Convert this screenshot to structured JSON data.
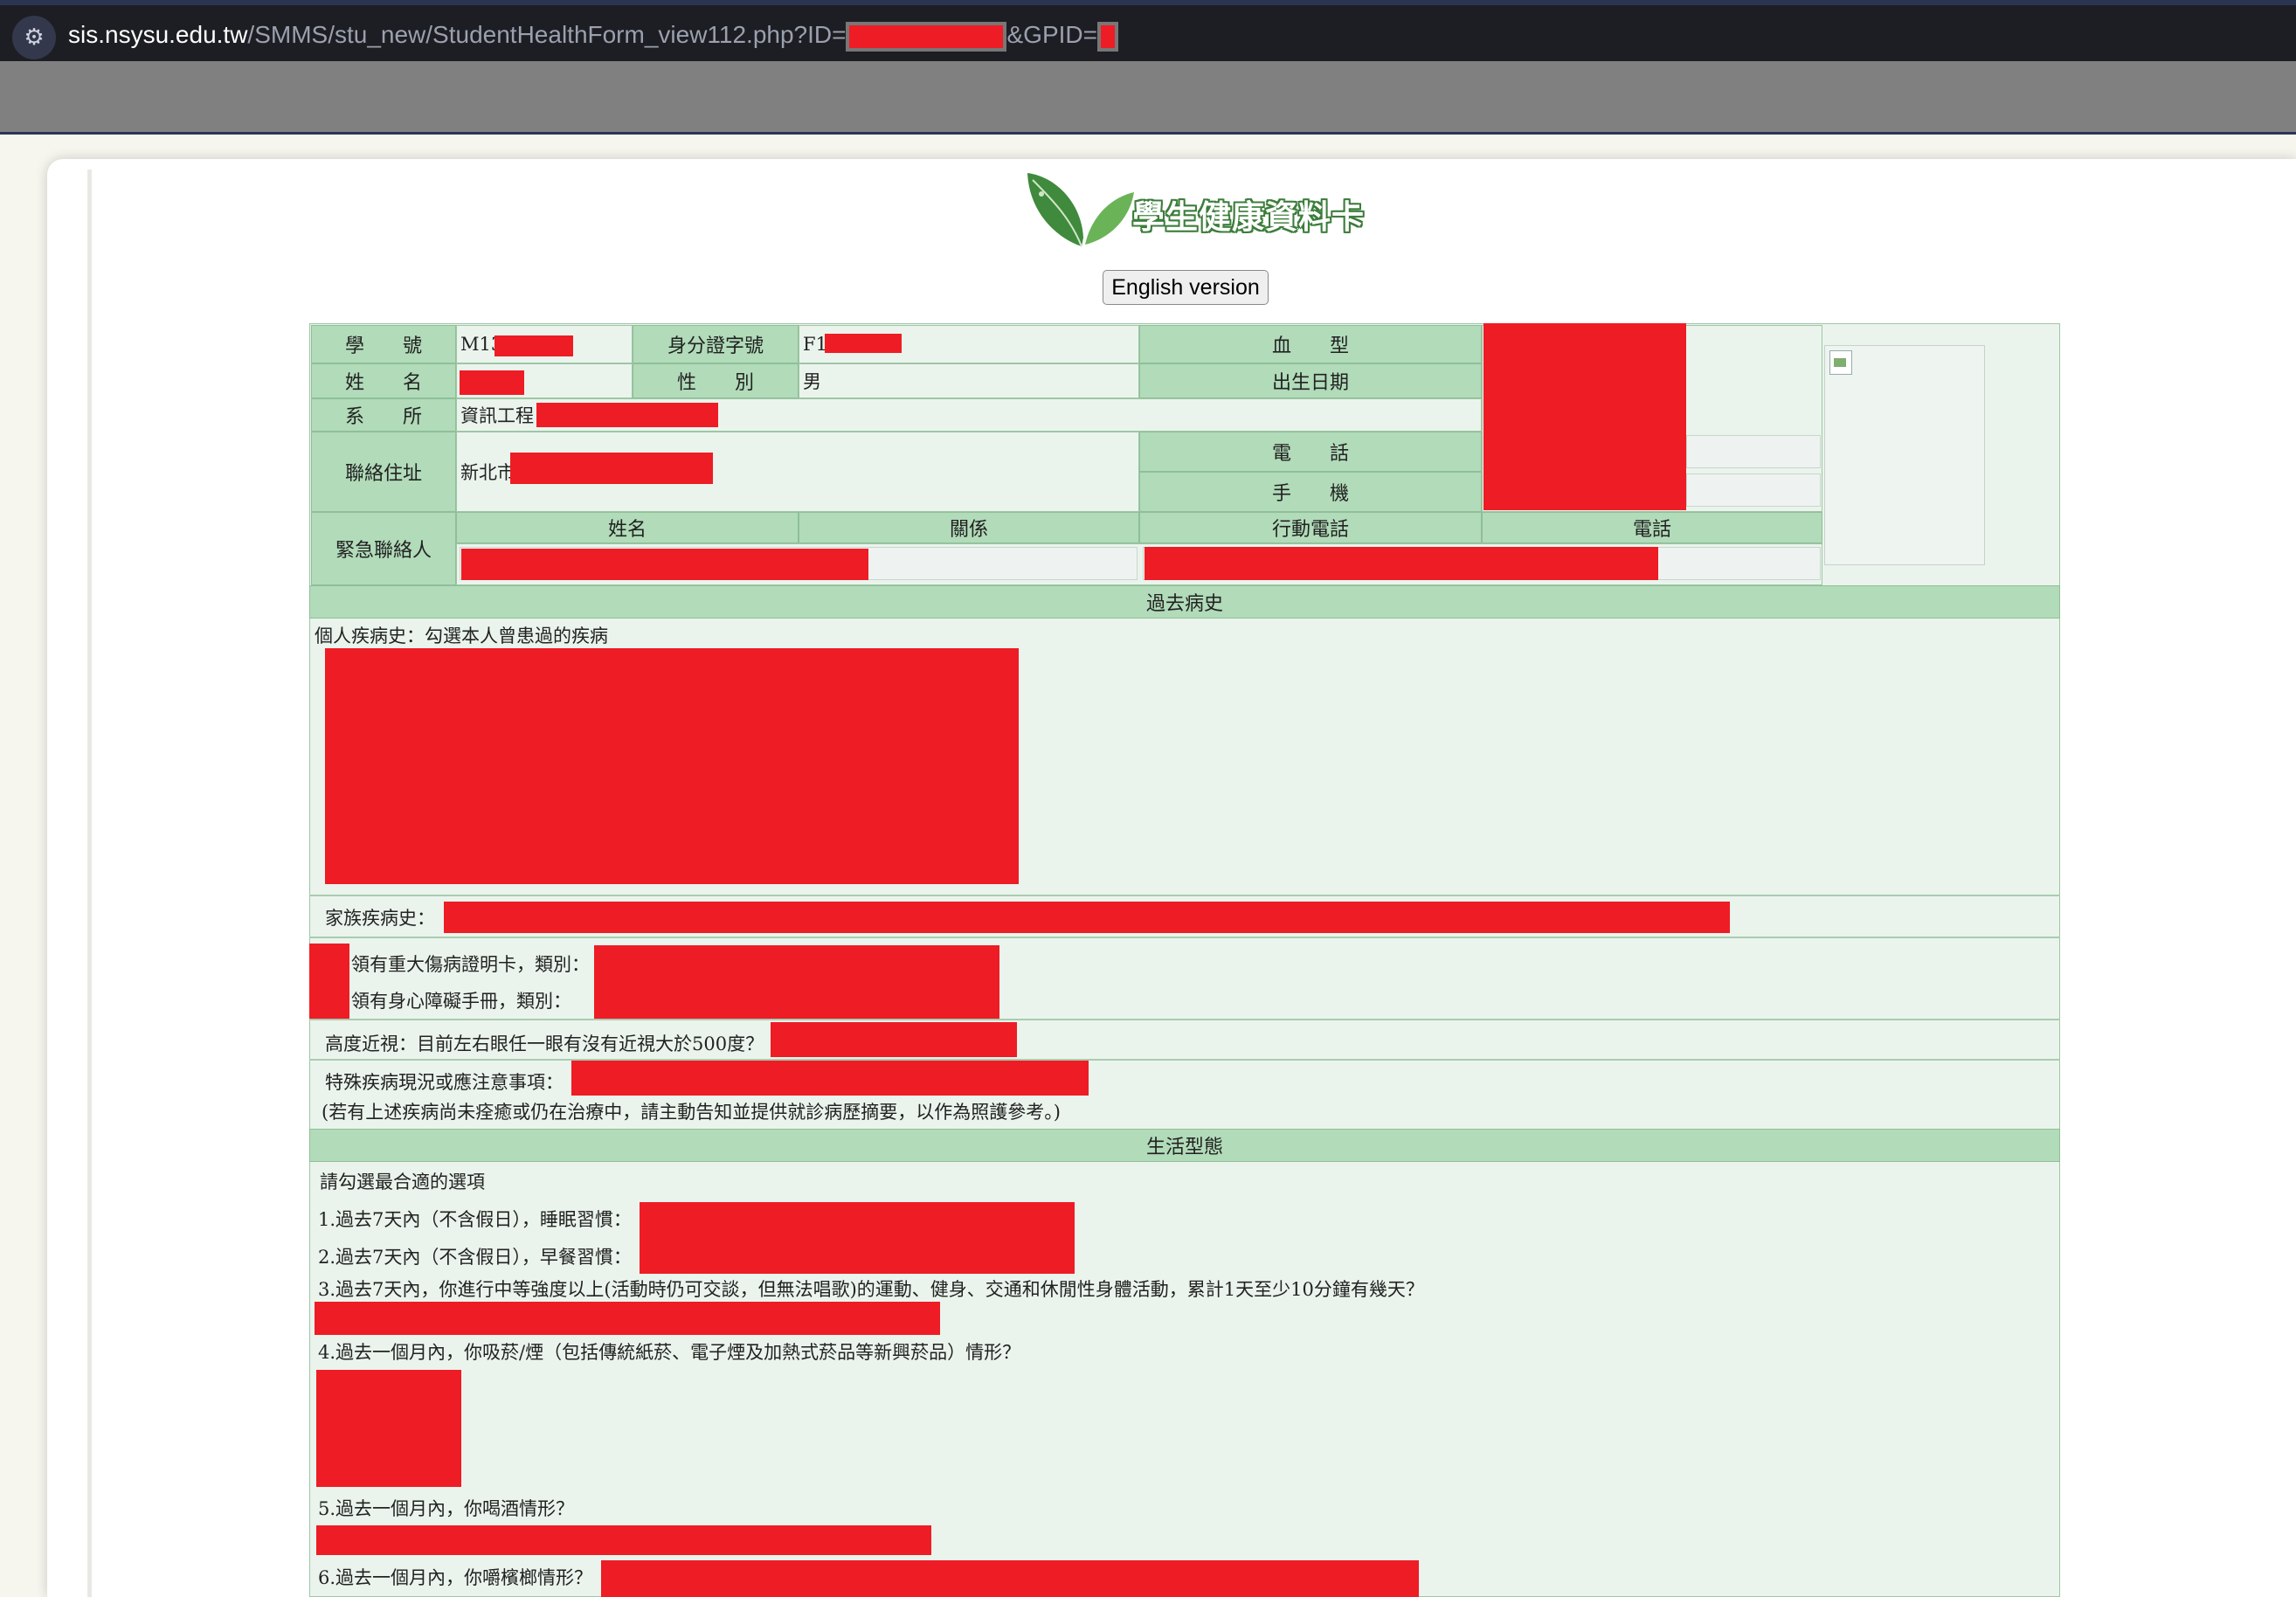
{
  "browser": {
    "url_host": "sis.nsysu.edu.tw",
    "url_path": "/SMMS/stu_new/StudentHealthForm_view112.php?ID=",
    "url_param2": "&GPID=",
    "settings_icon": "tune-icon"
  },
  "header": {
    "logo_icon": "leaf-icon",
    "logo_text": "學生健康資料卡",
    "english_button": "English version"
  },
  "basic": {
    "student_id_label": "學　　號",
    "student_id_value": "M13",
    "national_id_label": "身分證字號",
    "national_id_value": "F1",
    "blood_label": "血　　型",
    "name_label": "姓　　名",
    "gender_label": "性　　別",
    "gender_value": "男",
    "birthday_label": "出生日期",
    "dept_label": "系　　所",
    "dept_value": "資訊工程",
    "address_label": "聯絡住址",
    "address_value": "新北市",
    "phone_label": "電　　話",
    "mobile_label": "手　　機",
    "emergency_label": "緊急聯絡人",
    "em_name_header": "姓名",
    "em_relation_header": "關係",
    "em_mobile_header": "行動電話",
    "em_phone_header": "電話"
  },
  "history": {
    "title": "過去病史",
    "personal_label": "個人疾病史：勾選本人曾患過的疾病",
    "family_label": "家族疾病史：",
    "major_injury_label": "領有重大傷病證明卡，類別：",
    "disability_label": "領有身心障礙手冊，類別：",
    "myopia_label": "高度近視：目前左右眼任一眼有沒有近視大於500度？",
    "special_label": "特殊疾病現況或應注意事項：",
    "note": "(若有上述疾病尚未痊癒或仍在治療中，請主動告知並提供就診病歷摘要，以作為照護參考。)"
  },
  "lifestyle": {
    "title": "生活型態",
    "intro": "請勾選最合適的選項",
    "q1": "1.過去7天內（不含假日），睡眠習慣：",
    "q2": "2.過去7天內（不含假日），早餐習慣：",
    "q3": "3.過去7天內，你進行中等強度以上(活動時仍可交談，但無法唱歌)的運動、健身、交通和休閒性身體活動，累計1天至少10分鐘有幾天？",
    "q4": "4.過去一個月內，你吸菸/煙（包括傳統紙菸、電子煙及加熱式菸品等新興菸品）情形？",
    "q5": "5.過去一個月內，你喝酒情形？",
    "q6": "6.過去一個月內，你嚼檳榔情形？"
  },
  "colors": {
    "header_green": "#b1dbb9",
    "body_green": "#eaf4ec",
    "redaction": "#ee1c25"
  }
}
